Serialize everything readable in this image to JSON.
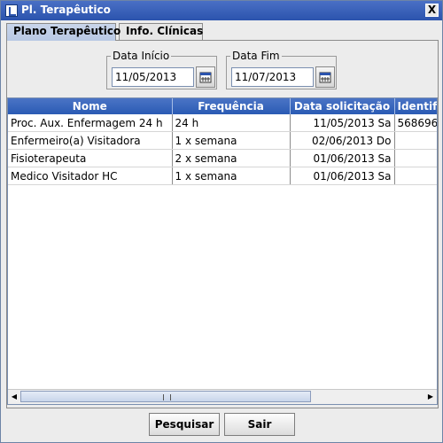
{
  "window": {
    "title": "Pl. Terapêutico",
    "close_label": "X"
  },
  "tabs": [
    {
      "label": "Plano Terapêutico",
      "active": true
    },
    {
      "label": "Info. Clínicas",
      "active": false
    }
  ],
  "filters": {
    "start": {
      "label": "Data Início",
      "value": "11/05/2013"
    },
    "end": {
      "label": "Data Fim",
      "value": "11/07/2013"
    }
  },
  "table": {
    "columns": [
      "Nome",
      "Frequência",
      "Data solicitação",
      "Identifi"
    ],
    "rows": [
      [
        "Proc. Aux. Enfermagem 24 h",
        "24 h",
        "11/05/2013 Sa",
        "568696"
      ],
      [
        "Enfermeiro(a) Visitadora",
        "1 x semana",
        "02/06/2013 Do",
        ""
      ],
      [
        "Fisioterapeuta",
        "2 x semana",
        "01/06/2013 Sa",
        ""
      ],
      [
        "Medico Visitador HC",
        "1 x semana",
        "01/06/2013 Sa",
        ""
      ]
    ]
  },
  "buttons": {
    "search": "Pesquisar",
    "exit": "Sair"
  },
  "colors": {
    "header_blue": "#2a5bb4",
    "tab_active": "#b8c8e4"
  }
}
